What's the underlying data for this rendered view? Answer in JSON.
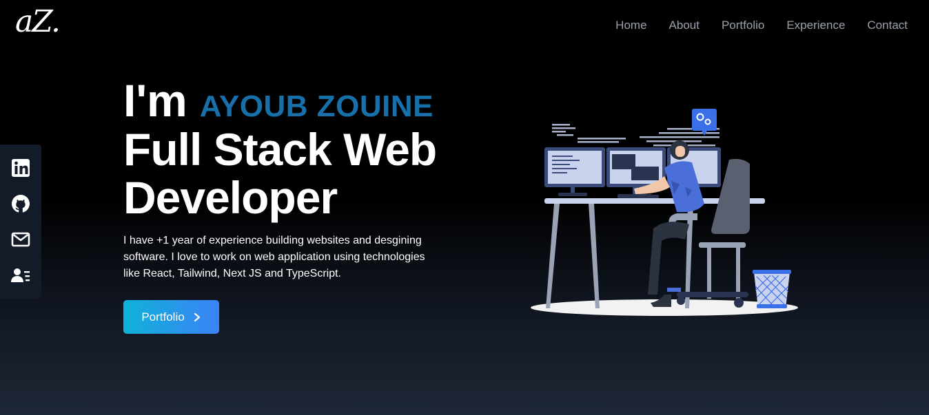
{
  "header": {
    "logo": "aZ.",
    "nav": [
      "Home",
      "About",
      "Portfolio",
      "Experience",
      "Contact"
    ]
  },
  "social": {
    "icons": [
      "linkedin-icon",
      "github-icon",
      "mail-icon",
      "resume-icon"
    ]
  },
  "hero": {
    "greeting": "I'm",
    "name": "AYOUB ZOUINE",
    "title": "Full Stack Web Developer",
    "description": "I have +1 year of experience building websites and desgining software. I love to work on web application using technologies like React, Tailwind, Next JS and TypeScript.",
    "cta_label": "Portfolio"
  },
  "colors": {
    "accent": "#1770aa",
    "button_start": "#0fb2d8",
    "button_end": "#3b82f6",
    "nav_text": "#9aa1ad"
  }
}
